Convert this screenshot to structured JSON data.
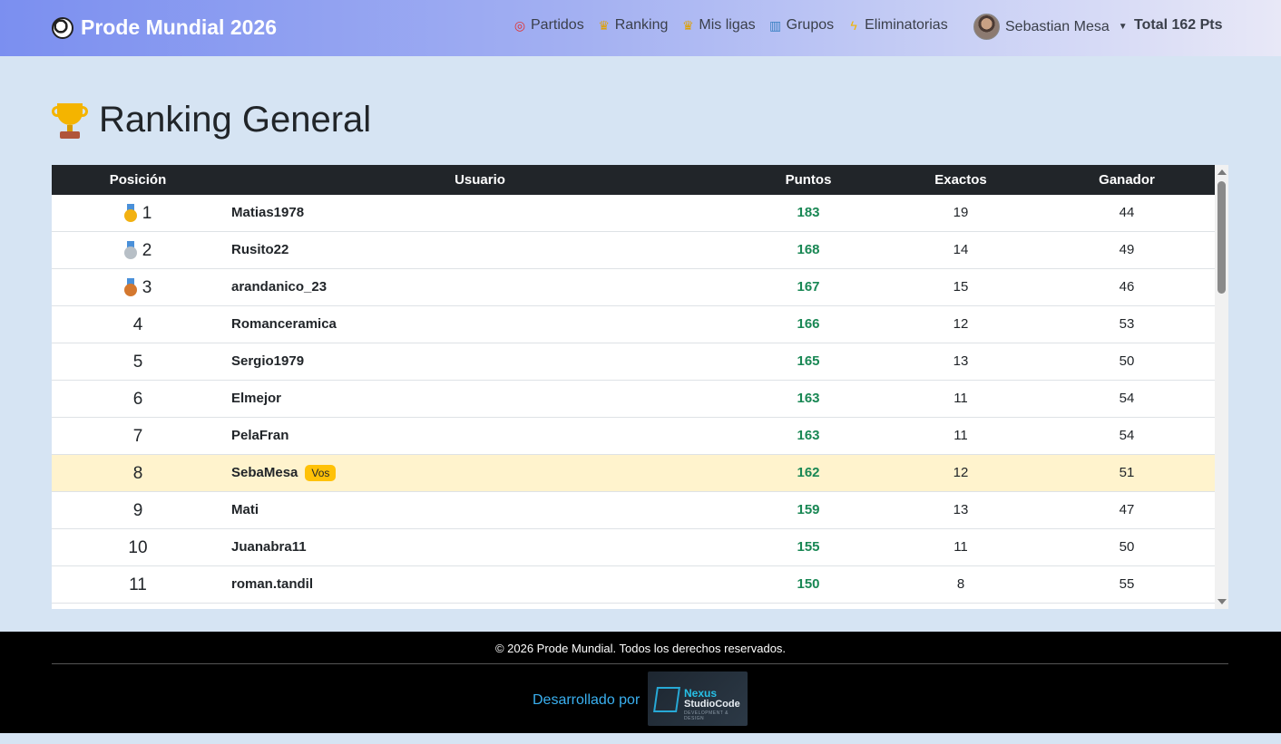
{
  "navbar": {
    "brand": "Prode Mundial 2026",
    "links": [
      {
        "label": "Partidos",
        "icon": "target-icon"
      },
      {
        "label": "Ranking",
        "icon": "trophy-icon"
      },
      {
        "label": "Mis ligas",
        "icon": "trophy-icon"
      },
      {
        "label": "Grupos",
        "icon": "bar-chart-icon"
      },
      {
        "label": "Eliminatorias",
        "icon": "lightning-icon"
      }
    ],
    "user_name": "Sebastian Mesa",
    "total": "Total 162 Pts"
  },
  "page": {
    "title": "Ranking General"
  },
  "table": {
    "headers": [
      "Posición",
      "Usuario",
      "Puntos",
      "Exactos",
      "Ganador"
    ],
    "rows": [
      {
        "pos": "1",
        "medal": "gold",
        "user": "Matias1978",
        "pts": "183",
        "exactos": "19",
        "ganador": "44"
      },
      {
        "pos": "2",
        "medal": "silver",
        "user": "Rusito22",
        "pts": "168",
        "exactos": "14",
        "ganador": "49"
      },
      {
        "pos": "3",
        "medal": "bronze",
        "user": "arandanico_23",
        "pts": "167",
        "exactos": "15",
        "ganador": "46"
      },
      {
        "pos": "4",
        "user": "Romanceramica",
        "pts": "166",
        "exactos": "12",
        "ganador": "53"
      },
      {
        "pos": "5",
        "user": "Sergio1979",
        "pts": "165",
        "exactos": "13",
        "ganador": "50"
      },
      {
        "pos": "6",
        "user": "Elmejor",
        "pts": "163",
        "exactos": "11",
        "ganador": "54"
      },
      {
        "pos": "7",
        "user": "PelaFran",
        "pts": "163",
        "exactos": "11",
        "ganador": "54"
      },
      {
        "pos": "8",
        "user": "SebaMesa",
        "badge": "Vos",
        "me": true,
        "pts": "162",
        "exactos": "12",
        "ganador": "51"
      },
      {
        "pos": "9",
        "user": "Mati",
        "pts": "159",
        "exactos": "13",
        "ganador": "47"
      },
      {
        "pos": "10",
        "user": "Juanabra11",
        "pts": "155",
        "exactos": "11",
        "ganador": "50"
      },
      {
        "pos": "11",
        "user": "roman.tandil",
        "pts": "150",
        "exactos": "8",
        "ganador": "55"
      }
    ]
  },
  "footer": {
    "copyright": "© 2026 Prode Mundial. Todos los derechos reservados.",
    "developed_by": "Desarrollado por",
    "logo_line1": "Nexus",
    "logo_line2": "StudioCode",
    "logo_line3": "DEVELOPMENT & DESIGN"
  },
  "colors": {
    "points_green": "#198754",
    "highlight_row": "#fff3cd",
    "badge_yellow": "#ffc107",
    "header_dark": "#212529"
  }
}
